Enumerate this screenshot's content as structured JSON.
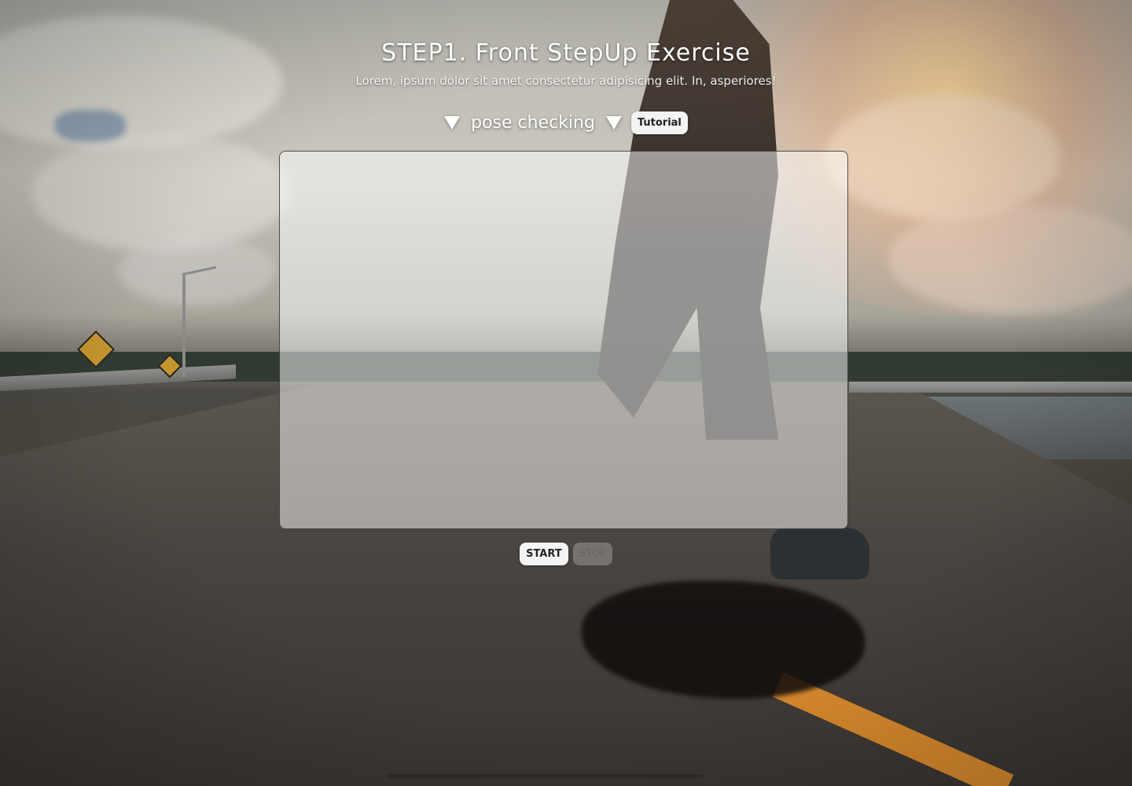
{
  "header": {
    "title": "STEP1. Front StepUp Exercise",
    "subtitle": "Lorem, ipsum dolor sit amet consectetur adipisicing elit. In, asperiores!"
  },
  "pose": {
    "label": "pose checking",
    "tutorial_label": "Tutorial"
  },
  "controls": {
    "start_label": "START",
    "stop_label": "STOP"
  },
  "colors": {
    "text": "#ffffff",
    "button_bg": "#f4f4f4",
    "lane_stripe": "#d88a2d"
  },
  "icons": {
    "pose_left": "triangle-down-icon",
    "pose_right": "triangle-down-icon"
  }
}
